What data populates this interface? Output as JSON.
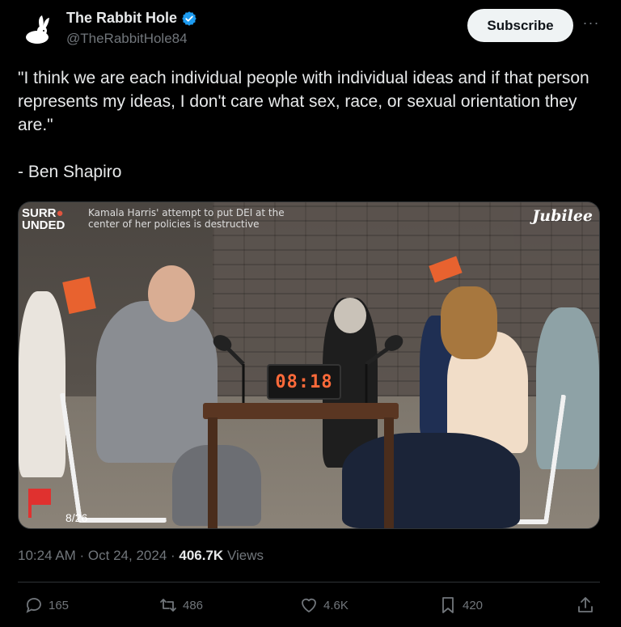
{
  "author": {
    "display_name": "The Rabbit Hole",
    "handle": "@TheRabbitHole84",
    "verified": true
  },
  "buttons": {
    "subscribe": "Subscribe",
    "more": "···"
  },
  "tweet": {
    "text": "\"I think we are each individual people with individual ideas and if that person represents my ideas, I don't care what sex, race, or sexual orientation they are.\"\n\n- Ben Shapiro"
  },
  "media": {
    "show_logo_line1": "SURR",
    "show_logo_line2": "UNDED",
    "caption": "Kamala Harris' attempt to put DEI at the center of her policies is destructive",
    "brand": "Jubilee",
    "clock": "08:18",
    "counter": "8/26"
  },
  "meta": {
    "time": "10:24 AM · Oct 24, 2024 · ",
    "views_count": "406.7K",
    "views_label": " Views"
  },
  "actions": {
    "replies": "165",
    "reposts": "486",
    "likes": "4.6K",
    "bookmarks": "420"
  },
  "colors": {
    "background": "#000000",
    "text_primary": "#e7e9ea",
    "text_secondary": "#71767b",
    "verified_blue": "#1d9bf0"
  }
}
